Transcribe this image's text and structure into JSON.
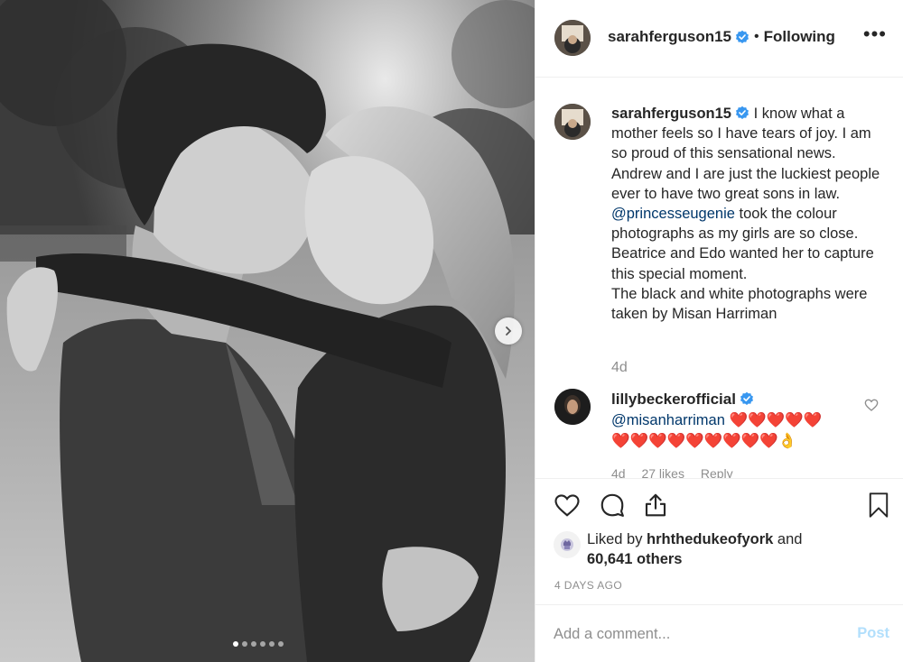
{
  "post": {
    "username": "sarahferguson15",
    "verified_icon": "verified-badge-icon",
    "separator": "•",
    "follow_status": "Following",
    "more_options": "•••",
    "image": {
      "description_icon": "photo-couple-embracing",
      "carousel_total": 6,
      "carousel_active": 1,
      "next_icon": "chevron-right-icon"
    }
  },
  "caption": {
    "username": "sarahferguson15",
    "text_before_mention": "I know what a mother feels so I have tears of joy. I am so proud of this sensational news. Andrew and I are just the luckiest people ever to have two great sons in law. ",
    "mention": "@princesseugenie",
    "text_after_mention": " took the colour photographs as my girls are so close. Beatrice and Edo wanted her to capture this special moment.\nThe black and white photographs were taken by Misan Harriman",
    "time": "4d"
  },
  "comment": {
    "username": "lillybeckerofficial",
    "mention": "@misanharriman",
    "hearts_line1": "❤️❤️❤️❤️❤️",
    "hearts_line2": "❤️❤️❤️❤️❤️❤️❤️❤️❤️👌",
    "time": "4d",
    "likes": "27 likes",
    "reply": "Reply"
  },
  "actions": {
    "like_icon": "heart-icon",
    "comment_icon": "comment-bubble-icon",
    "share_icon": "share-icon",
    "save_icon": "bookmark-icon"
  },
  "likes": {
    "prefix": "Liked by ",
    "liker": "hrhthedukeofyork",
    "middle": " and",
    "others": "60,641 others"
  },
  "timestamp": "4 DAYS AGO",
  "comment_box": {
    "placeholder": "Add a comment...",
    "post_label": "Post"
  },
  "colors": {
    "verified_blue": "#3897f0",
    "mention_blue": "#00376b",
    "post_disabled": "#b2dffc",
    "secondary_text": "#8e8e8e"
  }
}
